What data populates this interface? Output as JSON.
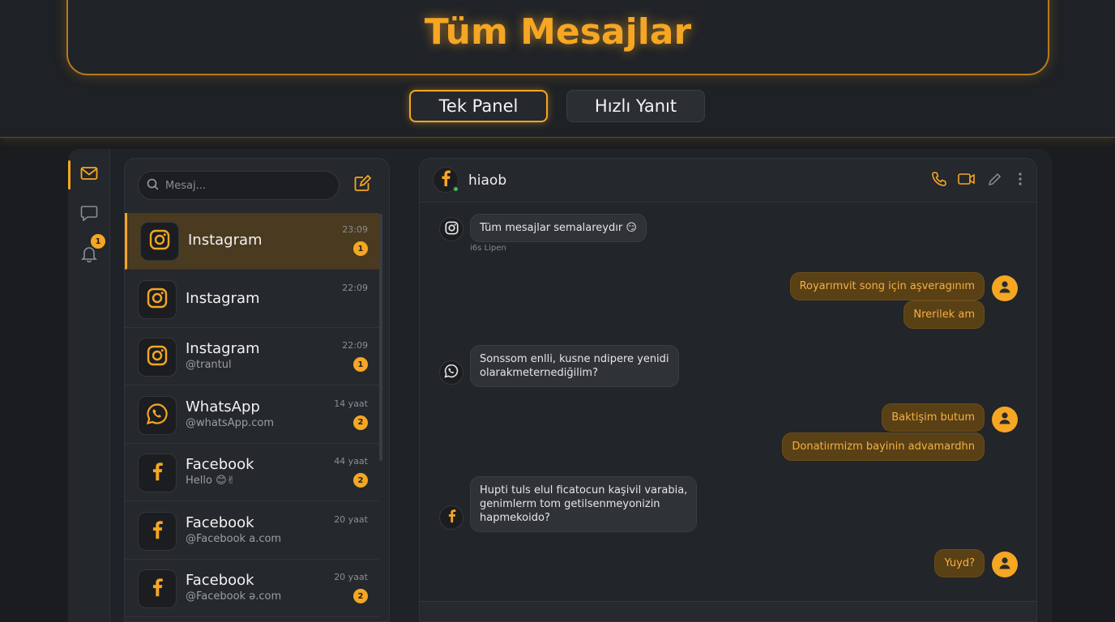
{
  "header": {
    "title": "Tüm Mesajlar",
    "modes": [
      "Tek Panel",
      "Hızlı Yanıt"
    ]
  },
  "rail": {
    "items": [
      {
        "icon": "mail-icon"
      },
      {
        "icon": "chat-bubble-icon"
      },
      {
        "icon": "bell-icon",
        "badge": "1"
      }
    ]
  },
  "list": {
    "search_placeholder": "Mesaj...",
    "conversations": [
      {
        "platform": "instagram",
        "name": "Instagram",
        "sub": "",
        "time": "23:09",
        "badge": "1",
        "active": true
      },
      {
        "platform": "instagram",
        "name": "Instagram",
        "sub": "",
        "time": "22:09",
        "badge": "",
        "active": false
      },
      {
        "platform": "instagram",
        "name": "Instagram",
        "sub": "@trantul",
        "time": "22:09",
        "badge": "1",
        "active": false
      },
      {
        "platform": "whatsapp",
        "name": "WhatsApp",
        "sub": "@whatsApp.com",
        "time": "14 yaat",
        "badge": "2",
        "active": false
      },
      {
        "platform": "facebook",
        "name": "Facebook",
        "sub": "Hello 😊✌",
        "time": "44 yaat",
        "badge": "2",
        "active": false
      },
      {
        "platform": "facebook",
        "name": "Facebook",
        "sub": "@Facebook a.com",
        "time": "20 yaat",
        "badge": "",
        "active": false
      },
      {
        "platform": "facebook",
        "name": "Facebook",
        "sub": "@Facebook ə.com",
        "time": "20 yaat",
        "badge": "2",
        "active": false
      }
    ]
  },
  "chat": {
    "contact_name": "hiaob",
    "messages": [
      {
        "dir": "in",
        "platform": "instagram",
        "lines": [
          "Tüm mesajlar semalareydır 😏"
        ],
        "meta": "i6s Lipen"
      },
      {
        "dir": "out",
        "lines": [
          "Royarımvit song için aşveragınım"
        ]
      },
      {
        "dir": "out",
        "lines": [
          "Nrerilek am"
        ]
      },
      {
        "dir": "in",
        "platform": "whatsapp",
        "lines": [
          "Sonssom enlli, kusne ndipere yenidi",
          "olarakmeternediğilim?"
        ]
      },
      {
        "dir": "out",
        "lines": [
          "Baktişim butum"
        ]
      },
      {
        "dir": "out",
        "lines": [
          "Donatiırmizm bayinin advamardhn"
        ]
      },
      {
        "dir": "in",
        "platform": "facebook",
        "lines": [
          "Hupti tuls elul ficatocun kaşivil varabia,",
          "genimlerm tom getilsenmeyonizin",
          "hapmekoido?"
        ]
      },
      {
        "dir": "out",
        "lines": [
          "Yuyd?"
        ]
      }
    ]
  },
  "colors": {
    "accent": "#f5a623",
    "background": "#1a1c1f",
    "panel": "#25282c",
    "online": "#3cc05a"
  }
}
